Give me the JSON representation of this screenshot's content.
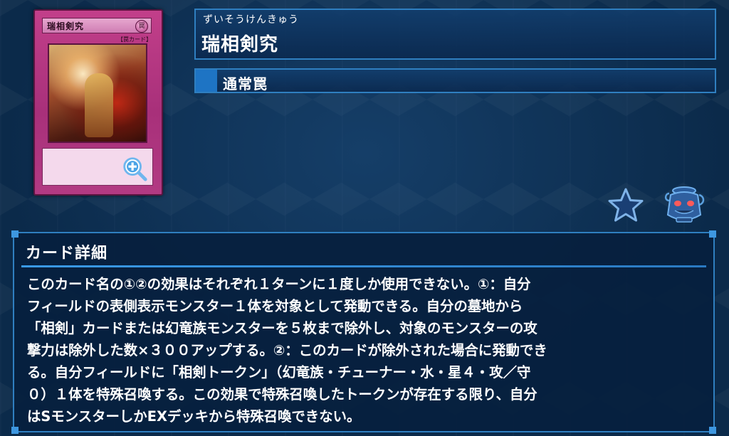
{
  "card_image": {
    "name": "瑞相剣究",
    "attribute_symbol": "罠",
    "type_line": "【罠カード】",
    "zoom_icon": "zoom-in-icon"
  },
  "card_name": {
    "ruby": "ずいそうけんきゅう",
    "title": "瑞相剣究"
  },
  "card_type": {
    "label": "通常罠"
  },
  "actions": {
    "favorite_icon": "star-icon",
    "deck_icon": "pot-of-greed-icon"
  },
  "detail": {
    "heading": "カード詳細",
    "lines": [
      "このカード名の①②の効果はそれぞれ１ターンに１度しか使用できない。①：自分",
      "フィールドの表側表示モンスター１体を対象として発動できる。自分の墓地から",
      "「相剣」カードまたは幻竜族モンスターを５枚まで除外し、対象のモンスターの攻",
      "撃力は除外した数×３００アップする。②：このカードが除外された場合に発動でき",
      "る。自分フィールドに「相剣トークン」（幻竜族・チューナー・水・星４・攻／守",
      "０）１体を特殊召喚する。この効果で特殊召喚したトークンが存在する限り、自分",
      "はSモンスターしかEXデッキから特殊召喚できない。"
    ]
  },
  "colors": {
    "background": "#0b2a4a",
    "panel_border": "#2f7fc0",
    "type_square": "#1e74c4",
    "card_frame": "#b23a83"
  }
}
